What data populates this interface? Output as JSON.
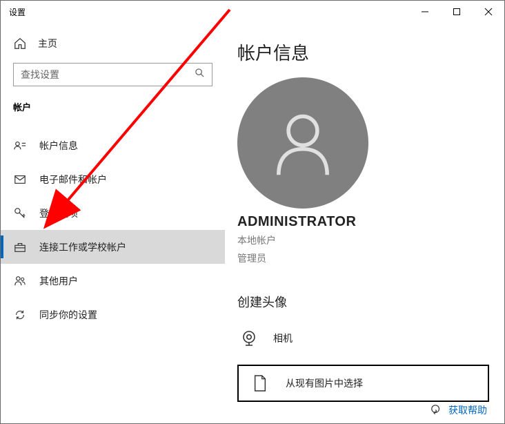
{
  "window": {
    "title": "设置"
  },
  "sidebar": {
    "home": "主页",
    "searchPlaceholder": "查找设置",
    "section": "帐户",
    "items": [
      {
        "label": "帐户信息"
      },
      {
        "label": "电子邮件和帐户"
      },
      {
        "label": "登录选项"
      },
      {
        "label": "连接工作或学校帐户"
      },
      {
        "label": "其他用户"
      },
      {
        "label": "同步你的设置"
      }
    ]
  },
  "main": {
    "pageTitle": "帐户信息",
    "username": "ADMINISTRATOR",
    "accountType": "本地帐户",
    "role": "管理员",
    "createAvatarHeading": "创建头像",
    "cameraLabel": "相机",
    "browseLabel": "从现有图片中选择",
    "helpLink": "获取帮助"
  }
}
